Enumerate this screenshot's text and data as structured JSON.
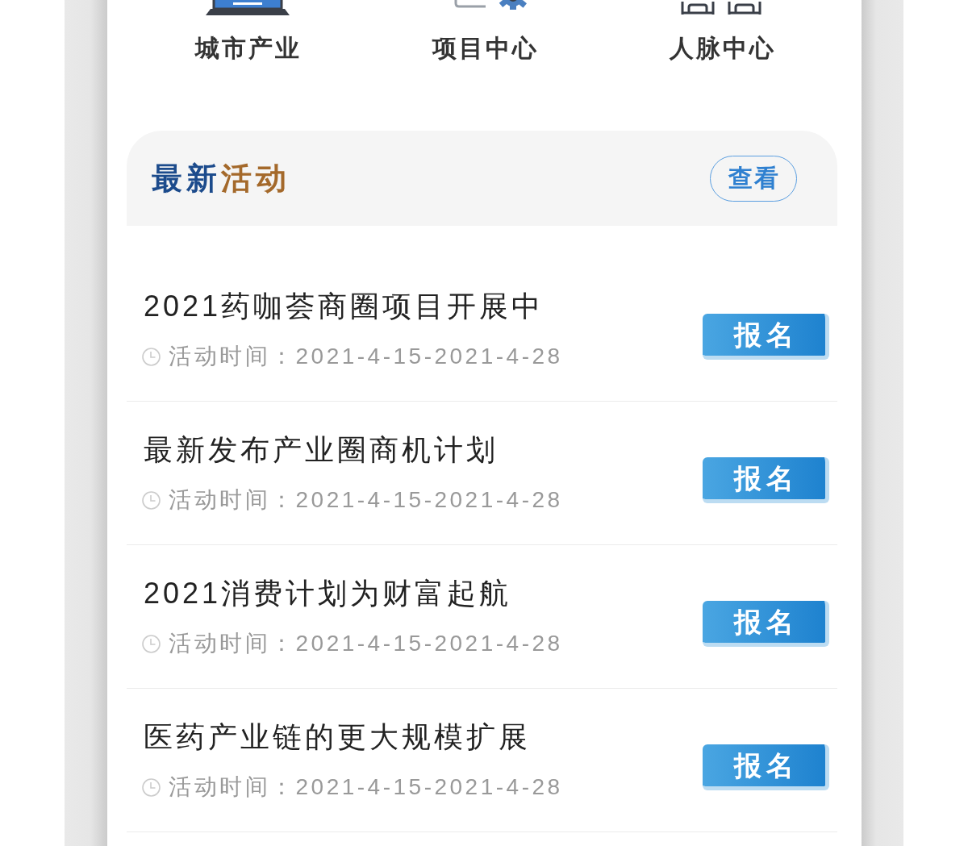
{
  "nav_items": [
    {
      "label": "城市产业",
      "kind": "laptop"
    },
    {
      "label": "项目中心",
      "kind": "gear"
    },
    {
      "label": "人脉中心",
      "kind": "people"
    }
  ],
  "section": {
    "title_segments": [
      {
        "text": "最新",
        "color": "#1c4b8c"
      },
      {
        "text": "活动",
        "color": "#a4692b"
      }
    ],
    "view_button": "查看"
  },
  "events": [
    {
      "title": "2021药咖荟商圈项目开展中",
      "time": "活动时间：2021-4-15-2021-4-28",
      "button": "报名"
    },
    {
      "title": "最新发布产业圈商机计划",
      "time": "活动时间：2021-4-15-2021-4-28",
      "button": "报名"
    },
    {
      "title": "2021消费计划为财富起航",
      "time": "活动时间：2021-4-15-2021-4-28",
      "button": "报名"
    },
    {
      "title": "医药产业链的更大规模扩展",
      "time": "活动时间：2021-4-15-2021-4-28",
      "button": "报名"
    }
  ]
}
